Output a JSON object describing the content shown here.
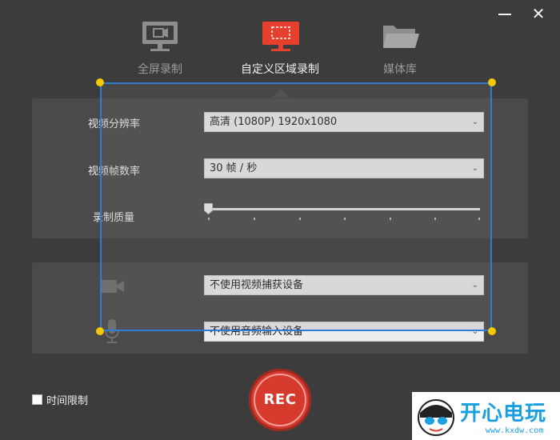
{
  "window": {
    "minimize": "—",
    "close": "✕"
  },
  "tabs": [
    {
      "label": "全屏录制",
      "icon": "monitor-icon",
      "active": false
    },
    {
      "label": "自定义区域录制",
      "icon": "region-monitor-icon",
      "active": true
    },
    {
      "label": "媒体库",
      "icon": "folder-icon",
      "active": false
    }
  ],
  "settings": {
    "resolution_label": "视频分辨率",
    "resolution_value": "高清 (1080P)   1920x1080",
    "framerate_label": "视频帧数率",
    "framerate_value": "30 帧 / 秒",
    "quality_label": "录制质量",
    "quality_value": 0
  },
  "devices": {
    "camera_value": "不使用视频捕获设备",
    "mic_value": "不使用音频输入设备"
  },
  "time_limit_label": "时间限制",
  "rec_label": "REC",
  "watermark": {
    "text": "开心电玩",
    "url": "www.kxdw.com"
  },
  "colors": {
    "accent_red": "#e8402f",
    "selection_blue": "#2f7bd6",
    "handle_yellow": "#f5c800",
    "background": "#3c3c3c",
    "panel": "#4a4a4a"
  }
}
